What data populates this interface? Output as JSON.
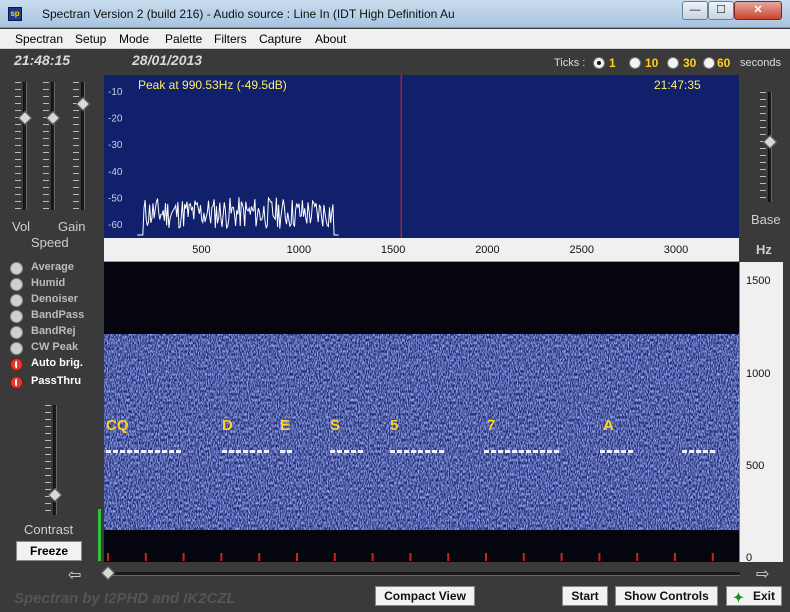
{
  "window": {
    "title": "Spectran Version 2 (build 216) - Audio source  :  Line In (IDT High Definition Au",
    "app_icon": "spectran-app-icon",
    "minimize_icon": "—",
    "maximize_icon": "☐",
    "close_icon": "✕"
  },
  "menu": [
    {
      "label": "Spectran"
    },
    {
      "label": "Setup"
    },
    {
      "label": "Mode"
    },
    {
      "label": "Palette"
    },
    {
      "label": "Filters"
    },
    {
      "label": "Capture"
    },
    {
      "label": "About"
    }
  ],
  "header": {
    "time": "21:48:15",
    "date": "28/01/2013",
    "ticks_label": "Ticks :",
    "ticks_options": [
      "1",
      "10",
      "30",
      "60"
    ],
    "ticks_selected": "1",
    "seconds_label": "seconds"
  },
  "left_panel": {
    "vol_label": "Vol",
    "gain_label": "Gain",
    "speed_label": "Speed",
    "contrast_label": "Contrast",
    "freeze_label": "Freeze",
    "sliders": {
      "vol": 0.28,
      "speed": 0.28,
      "gain": 0.17,
      "contrast": 0.82
    },
    "options": [
      {
        "label": "Average",
        "on": false
      },
      {
        "label": "Humid",
        "on": false
      },
      {
        "label": "Denoiser",
        "on": false
      },
      {
        "label": "BandPass",
        "on": false
      },
      {
        "label": "BandRej",
        "on": false
      },
      {
        "label": "CW Peak",
        "on": false
      },
      {
        "label": "Auto brig.",
        "on": true
      },
      {
        "label": "PassThru",
        "on": true
      }
    ]
  },
  "spectrum": {
    "peak_text": "Peak at   990.53Hz (-49.5dB)",
    "time": "21:47:35",
    "db_ticks": [
      "-10",
      "-20",
      "-30",
      "-40",
      "-50",
      "-60"
    ],
    "freq_ticks": [
      "500",
      "1000",
      "1500",
      "2000",
      "2500",
      "3000"
    ],
    "marker_hz": 1560,
    "trace_color": "#ffffff",
    "background_color": "#10206b"
  },
  "waterfall": {
    "hz_ticks": [
      "1500",
      "1000",
      "500",
      "0"
    ],
    "decoded_chars": [
      "CQ",
      "D",
      "E",
      "S",
      "5",
      "7",
      "A"
    ],
    "noise_color": "#5a6fd6"
  },
  "right_panel": {
    "base_label": "Base",
    "hz_label": "Hz",
    "base_slider": 0.45
  },
  "footer": {
    "credit": "Spectran  by I2PHD and IK2CZL",
    "compact_view_label": "Compact View",
    "start_label": "Start",
    "show_controls_label": "Show Controls",
    "exit_label": "Exit"
  }
}
